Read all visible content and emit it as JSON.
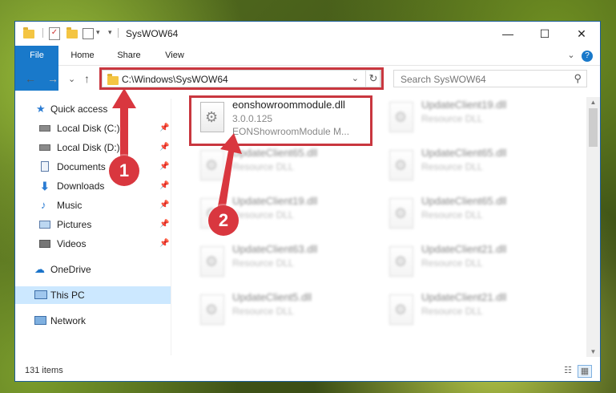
{
  "window": {
    "title": "SysWOW64",
    "minimize": "—",
    "maximize": "☐",
    "close": "✕"
  },
  "ribbon": {
    "tabs": [
      "File",
      "Home",
      "Share",
      "View"
    ],
    "expand": "⌄",
    "help": "?"
  },
  "navigation": {
    "back": "←",
    "forward": "→",
    "recent": "⌄",
    "up": "↑",
    "address": "C:\\Windows\\SysWOW64",
    "address_dropdown": "⌄",
    "refresh": "↻",
    "search_placeholder": "Search SysWOW64",
    "search_icon": "⚲"
  },
  "sidebar": {
    "items": [
      {
        "label": "Quick access",
        "icon": "star-icon",
        "pinned": false
      },
      {
        "label": "Local Disk (C:)",
        "icon": "drive-icon",
        "pinned": true
      },
      {
        "label": "Local Disk (D:)",
        "icon": "drive-icon",
        "pinned": true
      },
      {
        "label": "Documents",
        "icon": "documents-icon",
        "pinned": true
      },
      {
        "label": "Downloads",
        "icon": "download-icon",
        "pinned": true
      },
      {
        "label": "Music",
        "icon": "music-icon",
        "pinned": true
      },
      {
        "label": "Pictures",
        "icon": "pictures-icon",
        "pinned": true
      },
      {
        "label": "Videos",
        "icon": "videos-icon",
        "pinned": true
      },
      {
        "label": "OneDrive",
        "icon": "cloud-icon",
        "pinned": false
      },
      {
        "label": "This PC",
        "icon": "computer-icon",
        "pinned": false,
        "selected": true
      },
      {
        "label": "Network",
        "icon": "network-icon",
        "pinned": false
      }
    ],
    "pin_glyph": "📌"
  },
  "files": {
    "highlighted": {
      "name": "eonshowroommodule.dll",
      "version": "3.0.0.125",
      "description": "EONShowroomModule M..."
    },
    "others": [
      {
        "name": "UpdateClient19.dll",
        "type": "Resource DLL"
      },
      {
        "name": "UpdateClient65.dll",
        "type": "Resource DLL"
      },
      {
        "name": "UpdateClient65.dll",
        "type": "Resource DLL"
      },
      {
        "name": "UpdateClient19.dll",
        "type": "Resource DLL"
      },
      {
        "name": "UpdateClient65.dll",
        "type": "Resource DLL"
      },
      {
        "name": "UpdateClient63.dll",
        "type": "Resource DLL"
      },
      {
        "name": "UpdateClient21.dll",
        "type": "Resource DLL"
      },
      {
        "name": "UpdateClient5.dll",
        "type": "Resource DLL"
      },
      {
        "name": "UpdateClient21.dll",
        "type": "Resource DLL"
      }
    ]
  },
  "status": {
    "item_count": "131 items"
  },
  "callouts": {
    "one": "1",
    "two": "2"
  },
  "colors": {
    "accent": "#1979ca",
    "callout_red": "#d9373f",
    "selection": "#cce8ff"
  }
}
